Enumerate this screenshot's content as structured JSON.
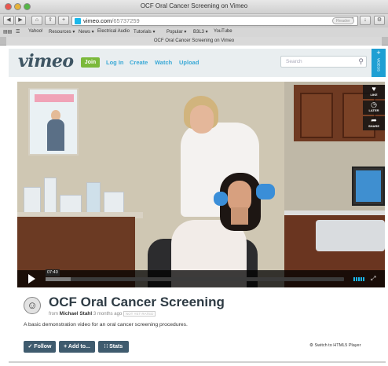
{
  "window": {
    "title": "OCF Oral Cancer Screening on Vimeo"
  },
  "toolbar": {
    "url_domain": "vimeo.com",
    "url_path": "/65737259",
    "reader_label": "Reader",
    "back_icon": "◀",
    "forward_icon": "▶",
    "share_icon": "⇪",
    "reload_icon": "C"
  },
  "bookmarks": [
    "Yahoo!",
    "Resources ▾",
    "News ▾",
    "Electrical Audio",
    "Tutorials ▾",
    "Popular ▾",
    "B3L3 ▾",
    "YouTube"
  ],
  "tab": {
    "label": "OCF Oral Cancer Screening on Vimeo"
  },
  "vimeo": {
    "logo": "vimeo",
    "join_label": "Join",
    "nav": [
      "Log In",
      "Create",
      "Watch",
      "Upload"
    ],
    "search_placeholder": "Search",
    "plus_label": "+",
    "plus_text": "VIDEOS",
    "brand_color": "#1ab7ea",
    "join_color": "#7bb93b"
  },
  "player": {
    "time": "07:40",
    "side_buttons": [
      {
        "icon": "♥",
        "label": "LIKE"
      },
      {
        "icon": "◷",
        "label": "LATER"
      },
      {
        "icon": "➦",
        "label": "SHARE"
      }
    ]
  },
  "video_info": {
    "title": "OCF Oral Cancer Screening",
    "from": "from",
    "author": "Michael Stahl",
    "age": "3 months ago",
    "tag": "NOT YET RATED",
    "description": "A basic demonstration video for an oral cancer screening procedures."
  },
  "actions": {
    "follow": "✓ Follow",
    "add_to": "+ Add to...",
    "stats": "∷ Stats",
    "html5": "⚙ Switch to HTML5 Player"
  }
}
